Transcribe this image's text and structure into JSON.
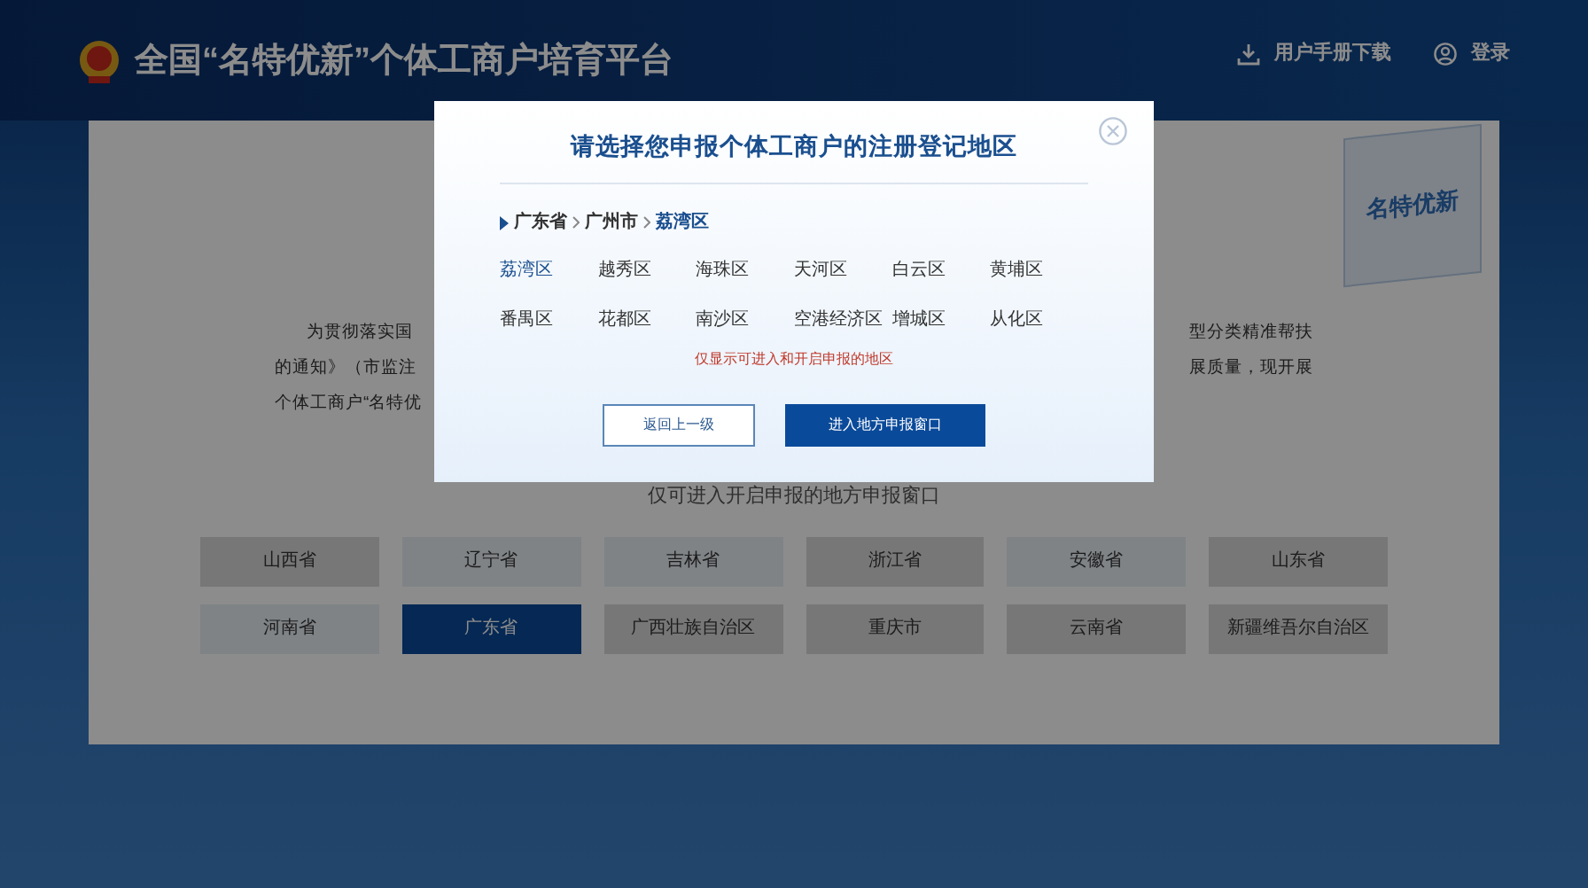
{
  "header": {
    "title": "全国“名特优新”个体工商户培育平台",
    "manual_link": "用户手册下载",
    "login_link": "登录"
  },
  "page": {
    "illustration_label": "名特优新",
    "intro_fragments": [
      {
        "left": "为贯彻落实国",
        "right": "型分类精准帮扶"
      },
      {
        "left": "的通知》（市监注",
        "right": "展质量，现开展"
      },
      {
        "left": "个体工商户“名特优"
      }
    ],
    "hint": "仅可进入开启申报的地方申报窗口",
    "provinces": [
      {
        "label": "山西省",
        "enabled": false,
        "selected": false
      },
      {
        "label": "辽宁省",
        "enabled": true,
        "selected": false
      },
      {
        "label": "吉林省",
        "enabled": true,
        "selected": false
      },
      {
        "label": "浙江省",
        "enabled": false,
        "selected": false
      },
      {
        "label": "安徽省",
        "enabled": true,
        "selected": false
      },
      {
        "label": "山东省",
        "enabled": false,
        "selected": false
      },
      {
        "label": "河南省",
        "enabled": true,
        "selected": false
      },
      {
        "label": "广东省",
        "enabled": true,
        "selected": true
      },
      {
        "label": "广西壮族自治区",
        "enabled": false,
        "selected": false
      },
      {
        "label": "重庆市",
        "enabled": false,
        "selected": false
      },
      {
        "label": "云南省",
        "enabled": false,
        "selected": false
      },
      {
        "label": "新疆维吾尔自治区",
        "enabled": false,
        "selected": false
      }
    ]
  },
  "dialog": {
    "title": "请选择您申报个体工商户的注册登记地区",
    "breadcrumb": [
      "广东省",
      "广州市",
      "荔湾区"
    ],
    "districts": [
      {
        "label": "荔湾区",
        "selected": true
      },
      {
        "label": "越秀区",
        "selected": false
      },
      {
        "label": "海珠区",
        "selected": false
      },
      {
        "label": "天河区",
        "selected": false
      },
      {
        "label": "白云区",
        "selected": false
      },
      {
        "label": "黄埔区",
        "selected": false
      },
      {
        "label": "番禺区",
        "selected": false
      },
      {
        "label": "花都区",
        "selected": false
      },
      {
        "label": "南沙区",
        "selected": false
      },
      {
        "label": "空港经济区",
        "selected": false
      },
      {
        "label": "增城区",
        "selected": false
      },
      {
        "label": "从化区",
        "selected": false
      }
    ],
    "notice": "仅显示可进入和开启申报的地区",
    "back_button": "返回上一级",
    "enter_button": "进入地方申报窗口"
  }
}
